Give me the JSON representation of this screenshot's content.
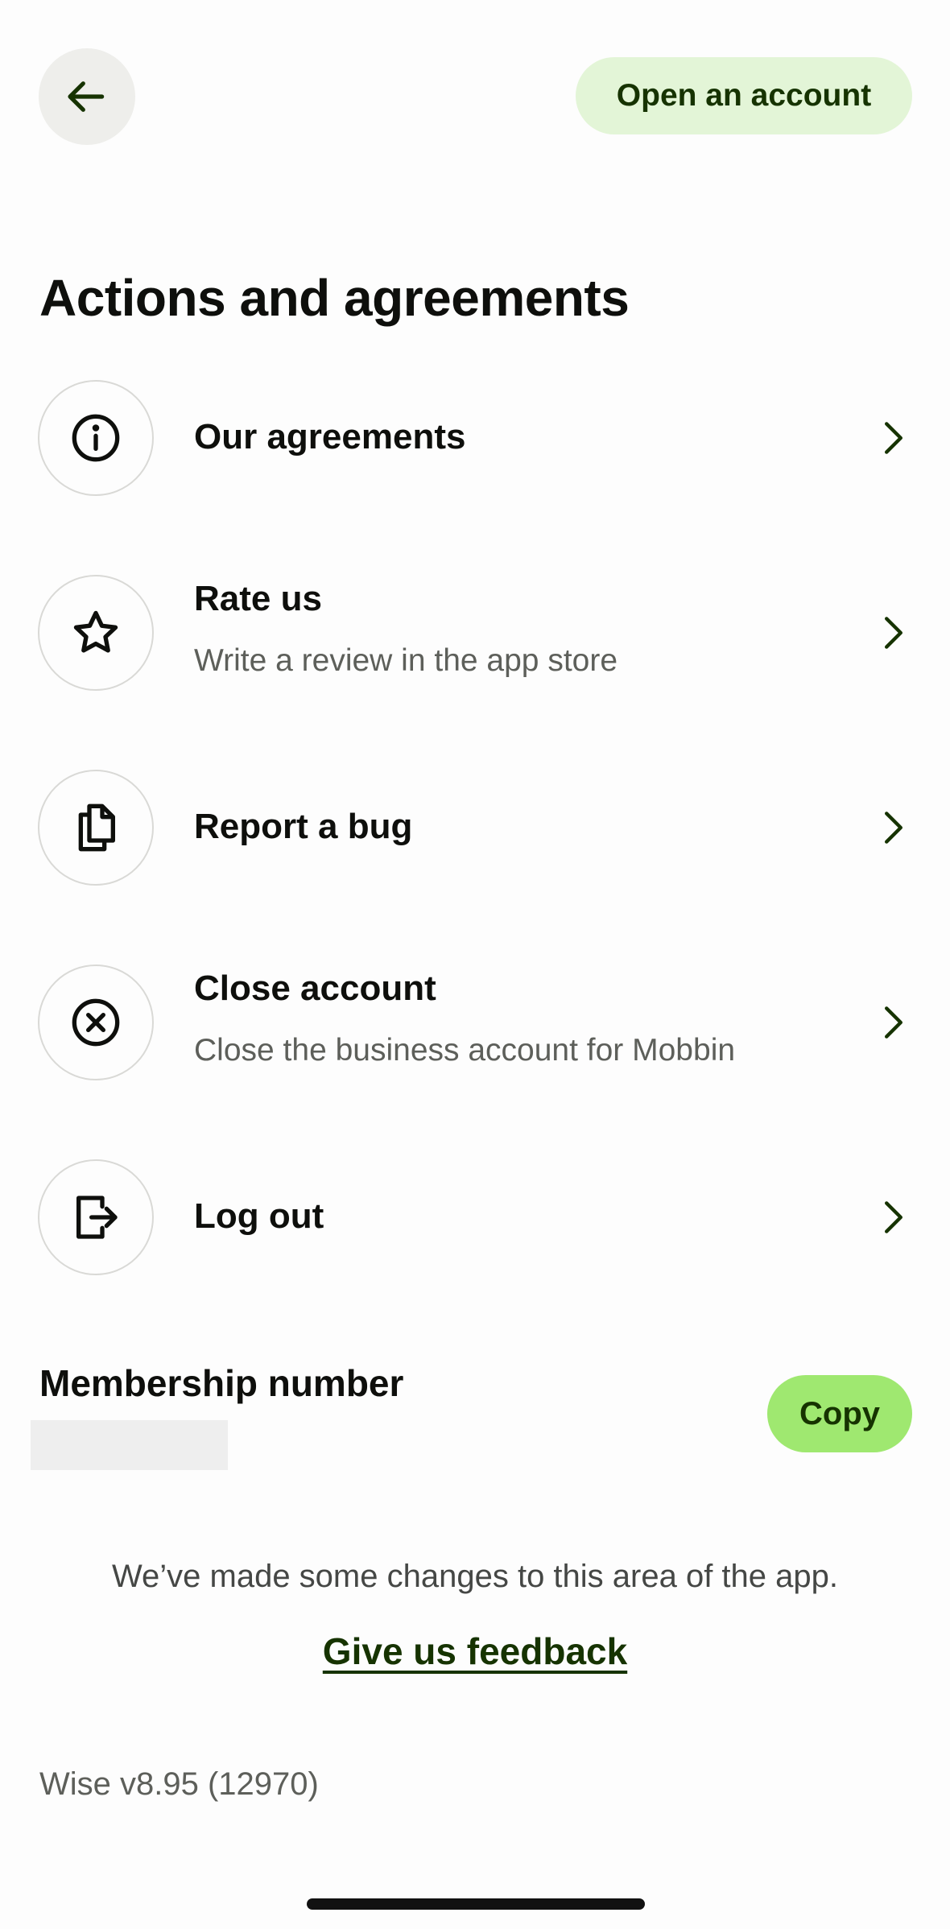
{
  "header": {
    "back_icon": "arrow-left-icon",
    "open_account_label": "Open an account"
  },
  "page_title": "Actions and agreements",
  "items": [
    {
      "icon": "info-icon",
      "title": "Our agreements",
      "subtitle": ""
    },
    {
      "icon": "star-icon",
      "title": "Rate us",
      "subtitle": "Write a review in the app store"
    },
    {
      "icon": "document-copy-icon",
      "title": "Report a bug",
      "subtitle": ""
    },
    {
      "icon": "close-circle-icon",
      "title": "Close account",
      "subtitle": "Close the business account for Mobbin"
    },
    {
      "icon": "logout-icon",
      "title": "Log out",
      "subtitle": ""
    }
  ],
  "membership": {
    "label": "Membership number",
    "copy_label": "Copy"
  },
  "footer": {
    "changes_text": "We’ve made some changes to this area of the app.",
    "feedback_link": "Give us feedback",
    "version": "Wise v8.95 (12970)"
  },
  "colors": {
    "brand_green_dark": "#163300",
    "brand_green_bright": "#9fe870",
    "brand_green_light": "#e3f5d7",
    "neutral_bg": "#eeeeeb"
  }
}
